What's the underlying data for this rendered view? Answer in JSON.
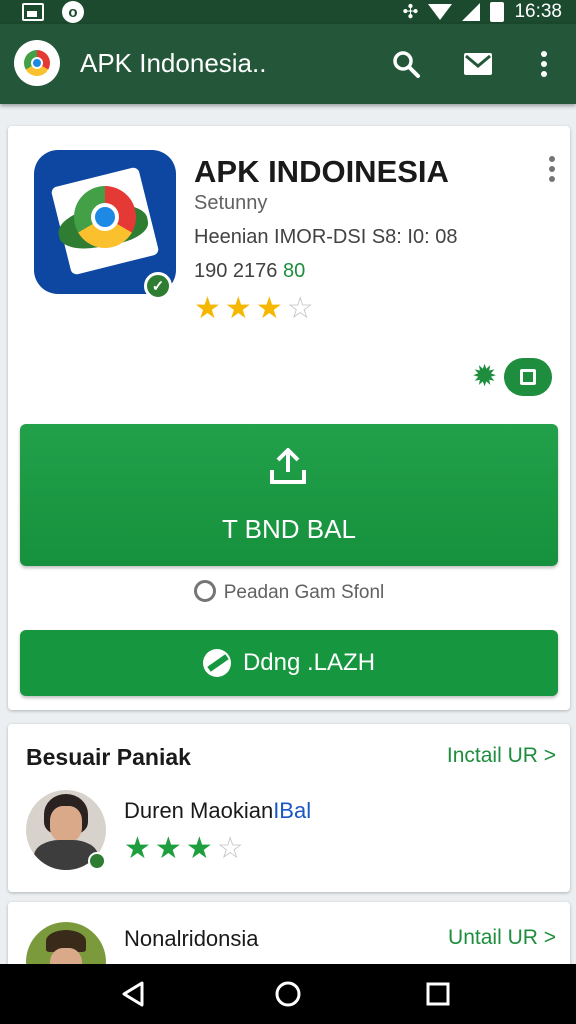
{
  "status_bar": {
    "time": "16:38"
  },
  "app_bar": {
    "title": "APK Indonesia..",
    "icons": [
      "app-logo-icon",
      "search-icon",
      "mail-icon",
      "more-vert-icon"
    ]
  },
  "app_card": {
    "name": "APK INDOINESIA",
    "subtitle": "Setunny",
    "meta": "Heenian IMOR-DSI S8: I0: 08",
    "count_prefix": "190 2176 ",
    "count_suffix": "80",
    "rating": 3,
    "rating_max": 4,
    "primary_button": "T BND BAL",
    "hint": "Peadan Gam Sfonl",
    "secondary_button": "Ddng .LAZH"
  },
  "section": {
    "title": "Besuair Paniak",
    "link": "Inctail UR >",
    "items": [
      {
        "name_main": "Duren Maokian",
        "name_accent": "IBal",
        "rating": 3,
        "rating_max": 4
      },
      {
        "name_main": "Nonalridonsia",
        "name_accent": "",
        "link": "Untail UR >"
      }
    ]
  },
  "colors": {
    "appbar": "#24573a",
    "statusbar": "#1b4a2e",
    "accent_green": "#1e8e3e",
    "star_gold": "#f6b700"
  }
}
